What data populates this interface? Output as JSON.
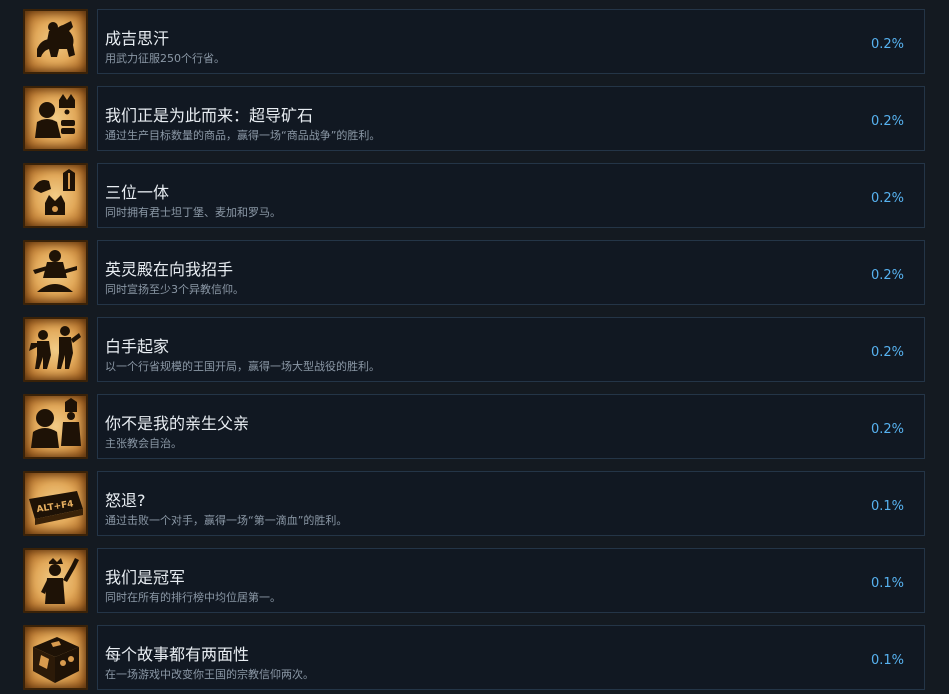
{
  "achievements": [
    {
      "title": "成吉思汗",
      "description": "用武力征服250个行省。",
      "percent": "0.2%",
      "icon": "horseman-icon"
    },
    {
      "title": "我们正是为此而来：超导矿石",
      "description": "通过生产目标数量的商品，赢得一场“商品战争”的胜利。",
      "percent": "0.2%",
      "icon": "merchant-coins-icon"
    },
    {
      "title": "三位一体",
      "description": "同时拥有君士坦丁堡、麦加和罗马。",
      "percent": "0.2%",
      "icon": "three-crowns-icon"
    },
    {
      "title": "英灵殿在向我招手",
      "description": "同时宣扬至少3个异教信仰。",
      "percent": "0.2%",
      "icon": "seated-deity-icon"
    },
    {
      "title": "白手起家",
      "description": "以一个行省规模的王国开局，赢得一场大型战役的胜利。",
      "percent": "0.2%",
      "icon": "dancing-figures-icon"
    },
    {
      "title": "你不是我的亲生父亲",
      "description": "主张教会自治。",
      "percent": "0.2%",
      "icon": "bishop-and-noble-icon"
    },
    {
      "title": "怒退?",
      "description": "通过击败一个对手，赢得一场“第一滴血”的胜利。",
      "percent": "0.1%",
      "icon": "keyboard-key-icon",
      "icon_text": "ALT+F4"
    },
    {
      "title": "我们是冠军",
      "description": "同时在所有的排行榜中均位居第一。",
      "percent": "0.1%",
      "icon": "king-raising-fist-icon"
    },
    {
      "title": "每个故事都有两面性",
      "description": "在一场游戏中改变你王国的宗教信仰两次。",
      "percent": "0.1%",
      "icon": "dice-icon"
    }
  ]
}
